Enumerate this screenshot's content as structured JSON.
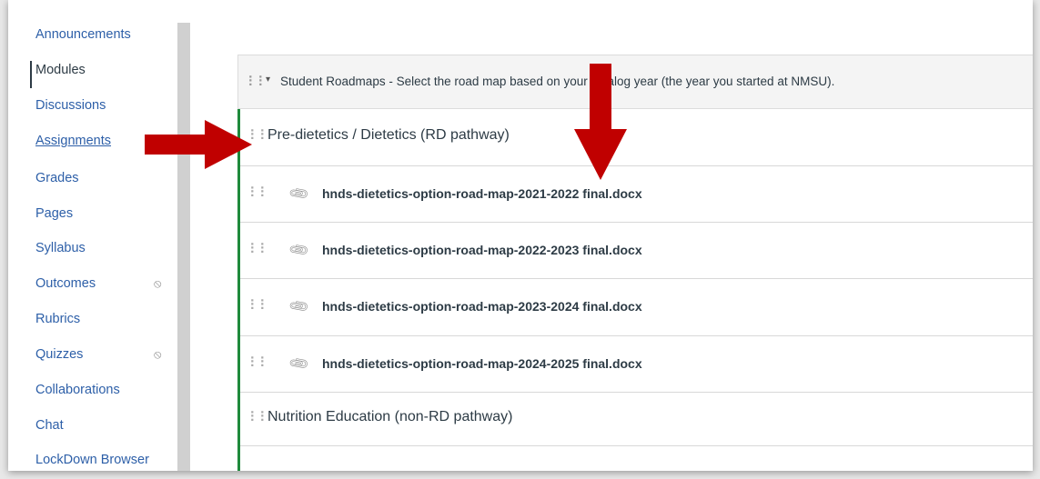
{
  "course_nav": {
    "items": [
      {
        "label": "Announcements",
        "active": false,
        "hidden": false
      },
      {
        "label": "Modules",
        "active": true,
        "hidden": false
      },
      {
        "label": "Discussions",
        "active": false,
        "hidden": false
      },
      {
        "label": "Assignments",
        "active": false,
        "hidden": false
      },
      {
        "label": "Grades",
        "active": false,
        "hidden": false
      },
      {
        "label": "Pages",
        "active": false,
        "hidden": false
      },
      {
        "label": "Syllabus",
        "active": false,
        "hidden": false
      },
      {
        "label": "Outcomes",
        "active": false,
        "hidden": true
      },
      {
        "label": "Rubrics",
        "active": false,
        "hidden": false
      },
      {
        "label": "Quizzes",
        "active": false,
        "hidden": true
      },
      {
        "label": "Collaborations",
        "active": false,
        "hidden": false
      },
      {
        "label": "Chat",
        "active": false,
        "hidden": false
      },
      {
        "label": "LockDown Browser",
        "active": false,
        "hidden": false
      }
    ],
    "hidden_icon": "eye-slash-icon"
  },
  "module": {
    "title": "Student Roadmaps - Select the road map based on your catalog year (the year you started at NMSU).",
    "collapse_icon": "caret-down-icon",
    "sections": [
      {
        "title": "Pre-dietetics / Dietetics (RD pathway)",
        "items": [
          {
            "title": "hnds-dietetics-option-road-map-2021-2022 final.docx",
            "icon": "paperclip-icon"
          },
          {
            "title": "hnds-dietetics-option-road-map-2022-2023 final.docx",
            "icon": "paperclip-icon"
          },
          {
            "title": "hnds-dietetics-option-road-map-2023-2024 final.docx",
            "icon": "paperclip-icon"
          },
          {
            "title": "hnds-dietetics-option-road-map-2024-2025 final.docx",
            "icon": "paperclip-icon"
          }
        ]
      },
      {
        "title": "Nutrition Education (non-RD pathway)",
        "items": []
      }
    ]
  },
  "annotations": {
    "arrow_color": "#c00000",
    "accent_border": "#1f8a3c",
    "link_color": "#2d5fa8"
  }
}
